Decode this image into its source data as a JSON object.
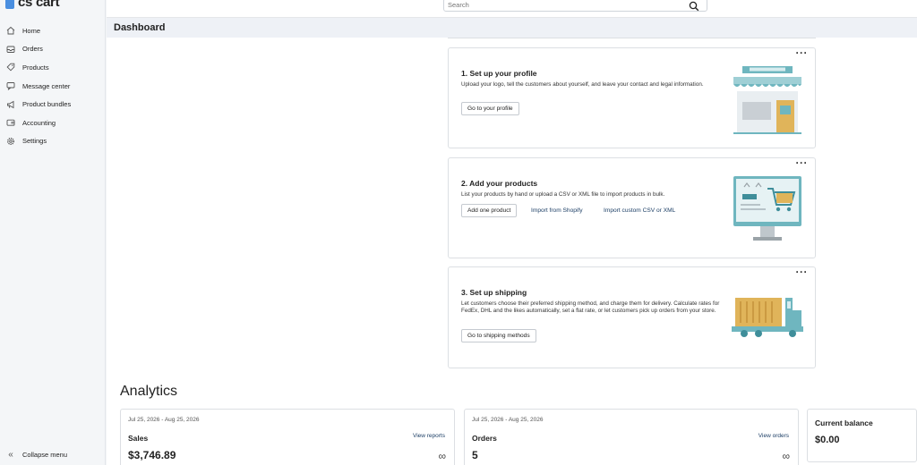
{
  "app": {
    "logo_text": "cs cart"
  },
  "colors": {
    "accent": "#4a8fe0",
    "teal": "#6fb6bf",
    "gold": "#e0b45a",
    "link": "#1d3f66"
  },
  "sidebar": {
    "items": [
      {
        "label": "Home",
        "icon": "home-icon"
      },
      {
        "label": "Orders",
        "icon": "inbox-icon"
      },
      {
        "label": "Products",
        "icon": "tag-icon"
      },
      {
        "label": "Message center",
        "icon": "chat-icon"
      },
      {
        "label": "Product bundles",
        "icon": "megaphone-icon"
      },
      {
        "label": "Accounting",
        "icon": "wallet-icon"
      },
      {
        "label": "Settings",
        "icon": "gear-icon"
      }
    ],
    "collapse_label": "Collapse menu"
  },
  "topbar": {
    "search_placeholder": "Search"
  },
  "header": {
    "title": "Dashboard"
  },
  "onboarding": {
    "profile": {
      "title": "1. Set up your profile",
      "description": "Upload your logo, tell the customers about yourself, and leave your contact and legal information.",
      "button": "Go to your profile"
    },
    "products": {
      "title": "2. Add your products",
      "description": "List your products by hand or upload a CSV or XML file to import products in bulk.",
      "button": "Add one product",
      "link_shopify": "Import from Shopify",
      "link_csv": "Import custom CSV or XML"
    },
    "shipping": {
      "title": "3. Set up shipping",
      "description": "Let customers choose their preferred shipping method, and charge them for delivery. Calculate rates for FedEx, DHL and the likes automatically, set a flat rate, or let customers pick up orders from your store.",
      "button": "Go to shipping methods"
    }
  },
  "analytics": {
    "title": "Analytics",
    "sales": {
      "range": "Jul 25, 2026 - Aug 25, 2026",
      "label": "Sales",
      "link": "View reports",
      "value": "$3,746.89"
    },
    "orders": {
      "range": "Jul 25, 2026 - Aug 25, 2026",
      "label": "Orders",
      "link": "View orders",
      "value": "5"
    },
    "balance": {
      "label": "Current balance",
      "value": "$0.00"
    }
  }
}
